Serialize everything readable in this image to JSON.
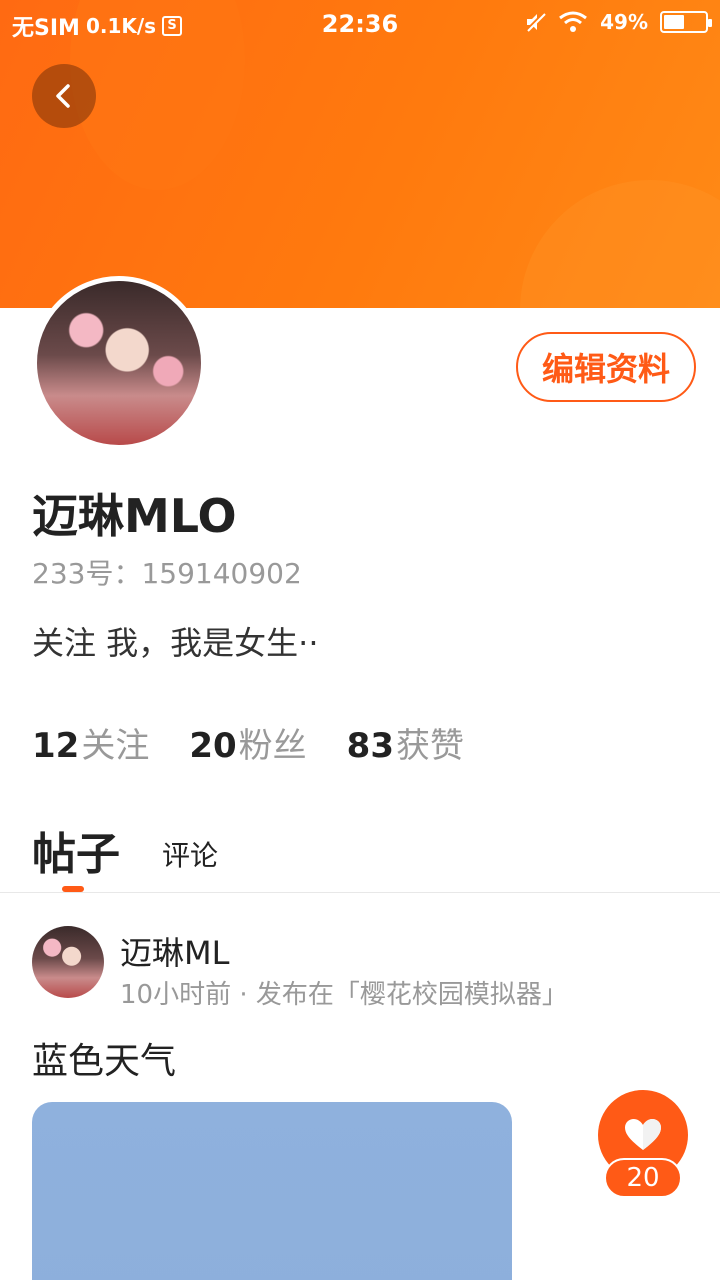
{
  "status_bar": {
    "carrier": "无SIM",
    "speed": "0.1K/s",
    "s_icon_letter": "S",
    "time": "22:36",
    "battery": "49%",
    "battery_level": 0.49
  },
  "profile": {
    "edit_label": "编辑资料",
    "name": "迈琳MLO",
    "id_text": "233号：159140902",
    "bio": "关注 我，我是女生··"
  },
  "stats": [
    {
      "num": "12",
      "label": "关注"
    },
    {
      "num": "20",
      "label": "粉丝"
    },
    {
      "num": "83",
      "label": "获赞"
    }
  ],
  "tabs": {
    "posts": "帖子",
    "comments": "评论"
  },
  "post": {
    "author": "迈琳ML",
    "meta": "10小时前 · 发布在「樱花校园模拟器」",
    "title": "蓝色天气",
    "likes": "20"
  },
  "colors": {
    "accent": "#ff5a16",
    "banner": "#ff7a0e",
    "image_blue": "#8fb1dd"
  }
}
